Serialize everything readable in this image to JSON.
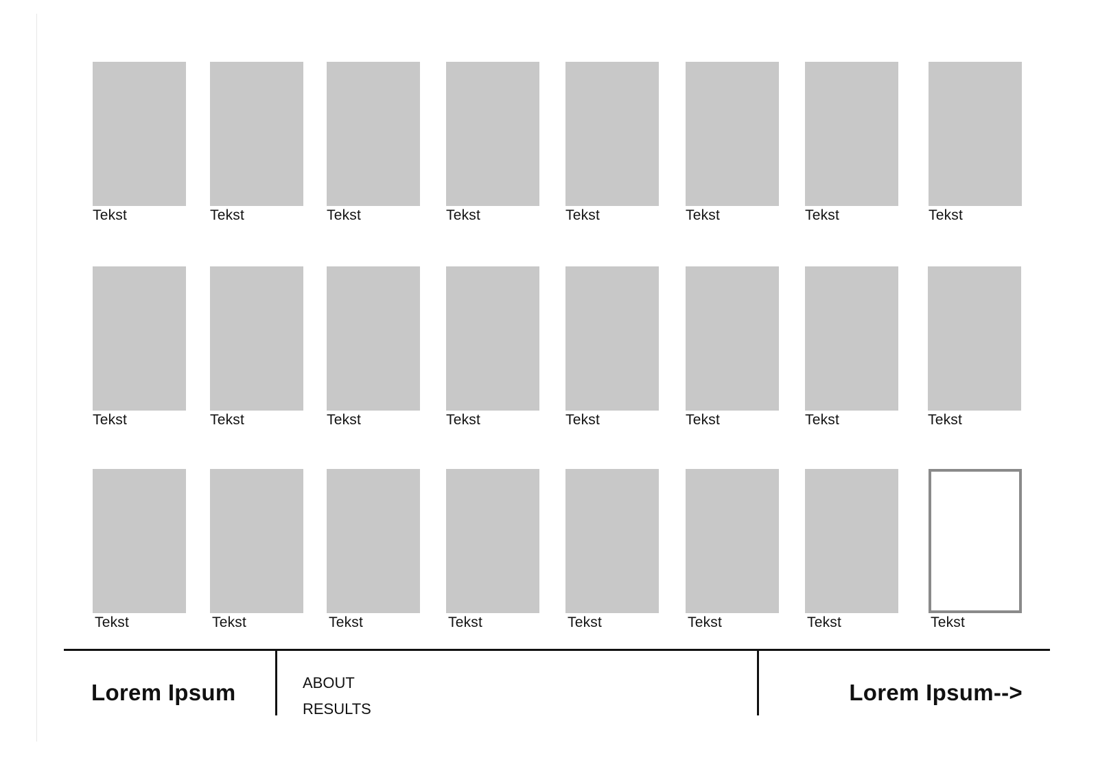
{
  "grid": {
    "rows": [
      [
        {
          "caption": "Tekst"
        },
        {
          "caption": "Tekst"
        },
        {
          "caption": "Tekst"
        },
        {
          "caption": "Tekst"
        },
        {
          "caption": "Tekst"
        },
        {
          "caption": "Tekst"
        },
        {
          "caption": "Tekst"
        },
        {
          "caption": "Tekst"
        }
      ],
      [
        {
          "caption": "Tekst"
        },
        {
          "caption": "Tekst"
        },
        {
          "caption": "Tekst"
        },
        {
          "caption": "Tekst"
        },
        {
          "caption": "Tekst"
        },
        {
          "caption": "Tekst"
        },
        {
          "caption": "Tekst"
        },
        {
          "caption": "Tekst"
        }
      ],
      [
        {
          "caption": "Tekst"
        },
        {
          "caption": "Tekst"
        },
        {
          "caption": "Tekst"
        },
        {
          "caption": "Tekst"
        },
        {
          "caption": "Tekst"
        },
        {
          "caption": "Tekst"
        },
        {
          "caption": "Tekst"
        },
        {
          "caption": "Tekst",
          "selected": true
        }
      ]
    ],
    "placeholder_color": "#c8c8c8",
    "selected_border_color": "#8a8a8a"
  },
  "footer": {
    "brand": "Lorem Ipsum",
    "nav": [
      {
        "label": "ABOUT"
      },
      {
        "label": "RESULTS"
      }
    ],
    "cta": "Lorem Ipsum-->"
  }
}
